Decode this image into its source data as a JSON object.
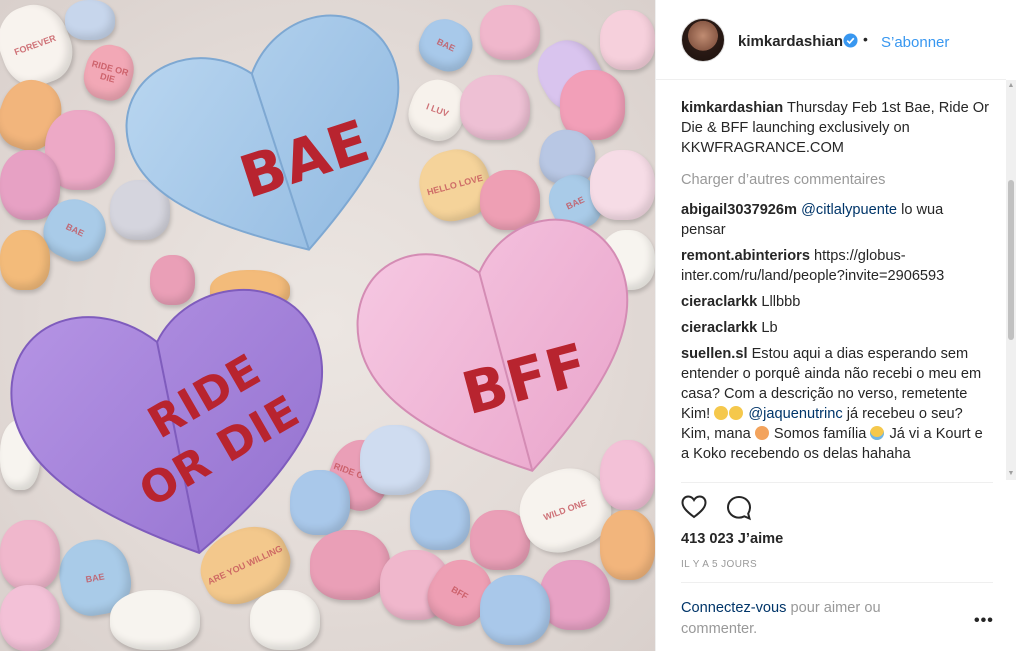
{
  "post": {
    "username": "kimkardashian",
    "follow_label": "S’abonner",
    "separator": "•",
    "caption": {
      "user": "kimkardashian",
      "text": "Thursday Feb 1st Bae, Ride Or Die & BFF launching exclusively on KKWFRAGRANCE.COM"
    },
    "load_more_label": "Charger d’autres commentaires",
    "comments": [
      {
        "user": "abigail3037926m",
        "mention": "@citlalypuente",
        "text": "lo wua pensar"
      },
      {
        "user": "remont.abinteriors",
        "text": "https://globus-inter.com/ru/land/people?invite=2906593"
      },
      {
        "user": "cieraclarkk",
        "text": "Lllbbb"
      },
      {
        "user": "cieraclarkk",
        "text": "Lb"
      },
      {
        "user": "suellen.sl",
        "text_a": "Estou aqui a dias esperando sem entender o porquê ainda não recebi o meu em casa? Com a descrição no verso, remetente Kim!",
        "mention": "@jaquenutrinc",
        "text_b": "já recebeu o seu? Kim, mana",
        "text_c": "Somos família",
        "text_d": "Já vi a Kourt e a Koko recebendo os delas hahaha"
      }
    ],
    "likes": "413 023 J’aime",
    "time": "IL Y A 5 JOURS",
    "login_link": "Connectez-vous",
    "login_text": " pour aimer ou commenter.",
    "more_label": "•••"
  },
  "image": {
    "heart_blue": "BAE",
    "heart_purple_1": "RIDE",
    "heart_purple_2": "OR DIE",
    "heart_pink": "BFF",
    "candies": [
      "BAE",
      "RIDE OR DIE",
      "BAE",
      "BFF",
      "FOREVER",
      "WILD ONE",
      "ARE YOU WILLING",
      "HELLO LOVE",
      "I LUV",
      "BAE",
      "BAE"
    ]
  },
  "colors": {
    "link_blue": "#3897f0",
    "mention_navy": "#003569",
    "heart_blue": "#9ec4e6",
    "heart_purple": "#a07ad6",
    "heart_pink": "#f0b3d6",
    "heart_text_red": "#b8242f"
  },
  "icons": [
    "verified-badge-icon",
    "heart-icon",
    "comment-bubble-icon",
    "more-options-icon"
  ]
}
